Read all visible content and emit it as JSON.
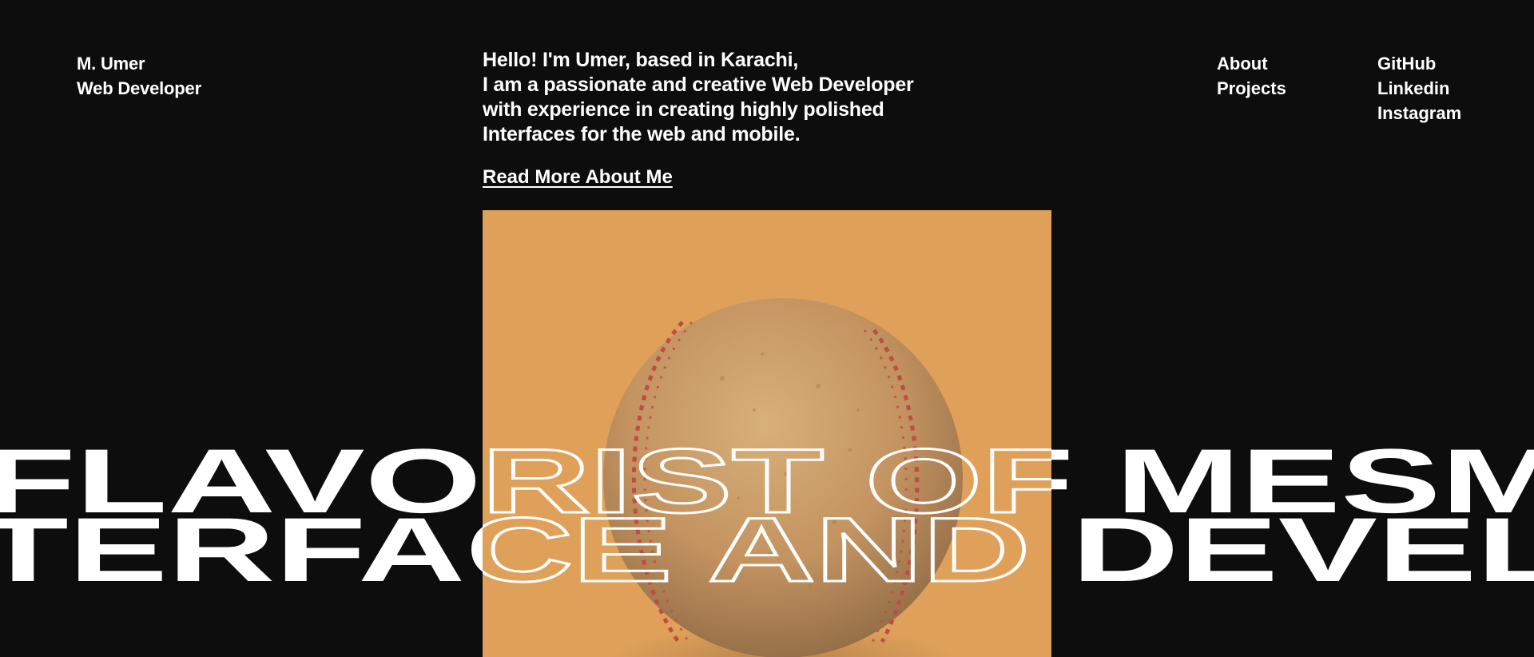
{
  "header": {
    "brand": {
      "name": "M. Umer",
      "role": "Web Developer"
    },
    "intro_lines": [
      "Hello! I'm Umer, based in Karachi,",
      "I am a passionate and creative Web Developer",
      "with experience in creating highly polished",
      "Interfaces for the web and mobile."
    ],
    "read_more": "Read More About Me",
    "nav": {
      "primary": [
        "About",
        "Projects"
      ],
      "social": [
        "GitHub",
        "Linkedin",
        "Instagram"
      ]
    }
  },
  "marquee": {
    "line1": "FLAVORIST OF MESM",
    "line2": "TERFACE AND DEVEL"
  },
  "hero_image": {
    "subject": "baseball",
    "background_color": "#dfa15a",
    "ball_color": "#c59a63",
    "stitch_color": "#c24a45"
  },
  "colors": {
    "background": "#0d0d0d",
    "text": "#ffffff"
  }
}
